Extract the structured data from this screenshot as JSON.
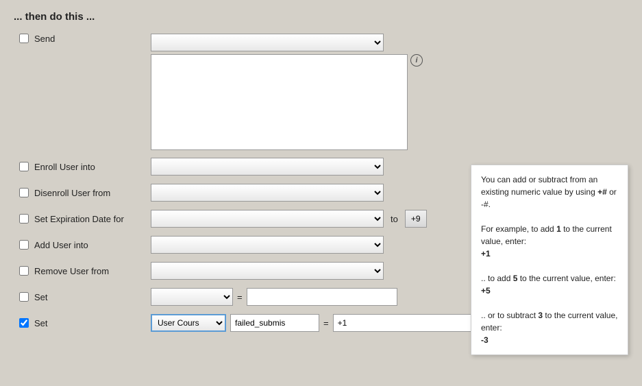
{
  "header": {
    "title": "... then do this ..."
  },
  "rows": [
    {
      "id": "send",
      "checkbox_checked": false,
      "label": "Send",
      "type": "send"
    },
    {
      "id": "enroll",
      "checkbox_checked": false,
      "label": "Enroll User into",
      "type": "dropdown"
    },
    {
      "id": "disenroll",
      "checkbox_checked": false,
      "label": "Disenroll User from",
      "type": "dropdown"
    },
    {
      "id": "expiration",
      "checkbox_checked": false,
      "label": "Set Expiration Date for",
      "type": "dropdown-to"
    },
    {
      "id": "add_user",
      "checkbox_checked": false,
      "label": "Add User into",
      "type": "dropdown"
    },
    {
      "id": "remove_user",
      "checkbox_checked": false,
      "label": "Remove User from",
      "type": "dropdown"
    },
    {
      "id": "set_empty",
      "checkbox_checked": false,
      "label": "Set",
      "type": "set-empty"
    },
    {
      "id": "set_filled",
      "checkbox_checked": true,
      "label": "Set",
      "type": "set-filled",
      "dropdown_value": "User Cours",
      "field_name": "failed_submis",
      "field_value": "+1"
    }
  ],
  "tooltip": {
    "line1": "You can add or subtract from an existing numeric value by using",
    "bold1": "+#",
    "line2": "or -#.",
    "example1_prefix": "For example, to add",
    "example1_num": "1",
    "example1_suffix": "to the current value, enter:",
    "example1_value": "+1",
    "example2_prefix": ".. to add",
    "example2_num": "5",
    "example2_suffix": "to the current value, enter:",
    "example2_value": "+5",
    "example3_prefix": ".. or to subtract",
    "example3_num": "3",
    "example3_suffix": "to the current value, enter:",
    "example3_value": "-3"
  },
  "labels": {
    "to": "to",
    "eq": "=",
    "plus9": "+9",
    "info": "i",
    "failed_submis": "failed_submis",
    "plus1": "+1"
  }
}
